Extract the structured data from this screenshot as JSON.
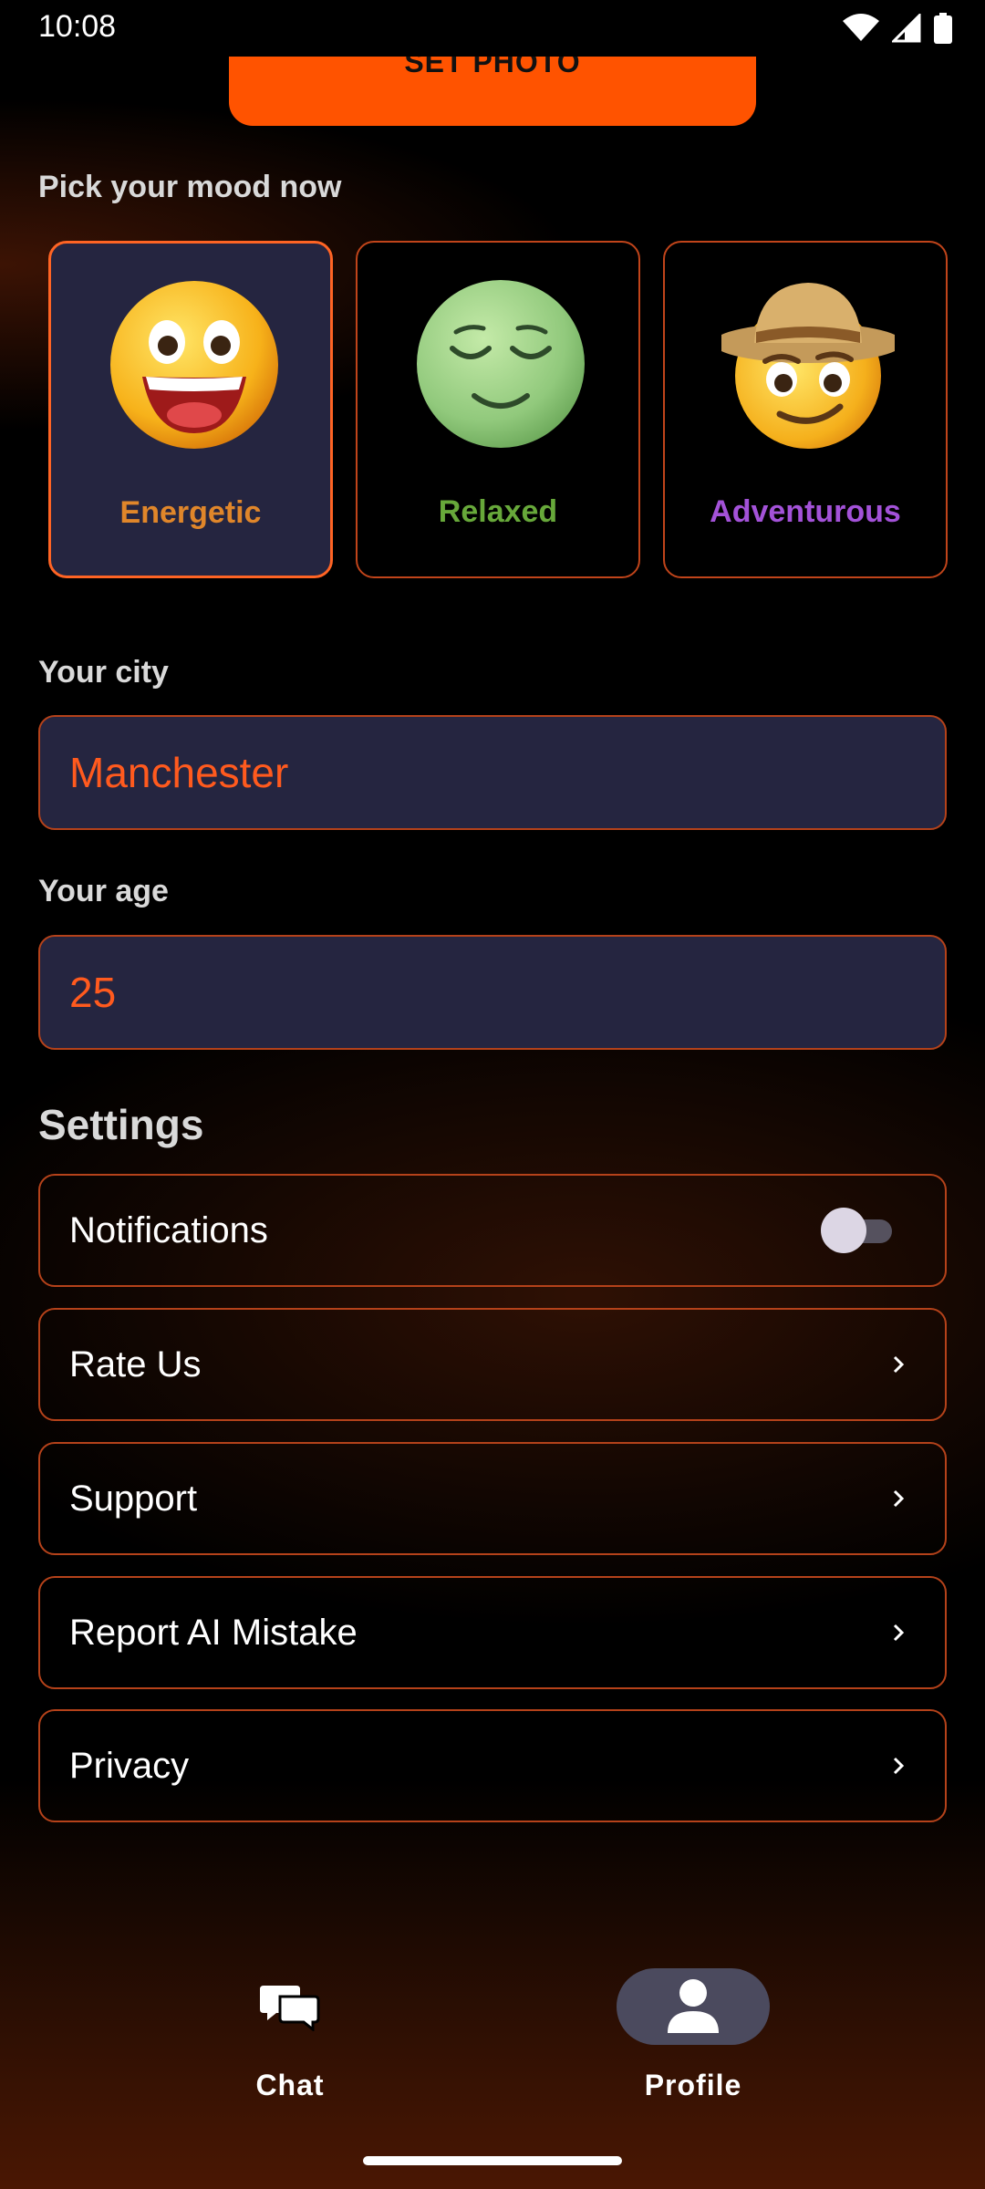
{
  "status_bar": {
    "time": "10:08",
    "icons": [
      "wifi-icon",
      "signal-icon",
      "battery-icon"
    ]
  },
  "set_photo": {
    "label": "SET PHOTO"
  },
  "mood": {
    "heading": "Pick your mood now",
    "items": [
      {
        "label": "Energetic",
        "icon": "grinning-face-emoji",
        "color": "#e0862a",
        "selected": true
      },
      {
        "label": "Relaxed",
        "icon": "relieved-face-emoji",
        "color": "#67a83a",
        "selected": false
      },
      {
        "label": "Adventurous",
        "icon": "explorer-face-emoji",
        "color": "#a352d8",
        "selected": false
      }
    ]
  },
  "city": {
    "label": "Your city",
    "value": "Manchester"
  },
  "age": {
    "label": "Your age",
    "value": "25"
  },
  "settings": {
    "title": "Settings",
    "items": [
      {
        "label": "Notifications",
        "control": "toggle",
        "toggle_on": false
      },
      {
        "label": "Rate Us",
        "control": "chevron"
      },
      {
        "label": "Support",
        "control": "chevron"
      },
      {
        "label": "Report AI Mistake",
        "control": "chevron"
      },
      {
        "label": "Privacy",
        "control": "chevron"
      }
    ]
  },
  "nav": {
    "items": [
      {
        "label": "Chat",
        "icon": "chat-bubbles-icon",
        "active": false
      },
      {
        "label": "Profile",
        "icon": "person-icon",
        "active": true
      }
    ]
  },
  "colors": {
    "accent": "#ff5300",
    "field_bg": "#252540",
    "border": "#b5421a",
    "field_text": "#ff5a1e"
  }
}
